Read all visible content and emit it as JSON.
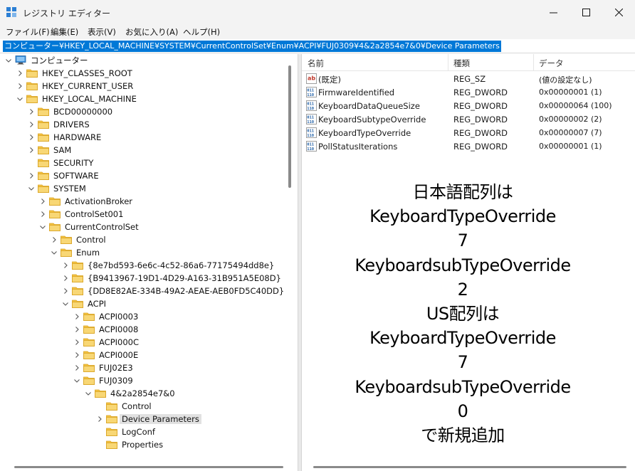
{
  "window": {
    "title": "レジストリ エディター",
    "minimize_icon": "minimize-icon",
    "maximize_icon": "maximize-icon",
    "close_icon": "close-icon"
  },
  "menu": [
    "ファイル(F)",
    "編集(E)",
    "表示(V)",
    "お気に入り(A)",
    "ヘルプ(H)"
  ],
  "address": "コンピューター¥HKEY_LOCAL_MACHINE¥SYSTEM¥CurrentControlSet¥Enum¥ACPI¥FUJ0309¥4&2a2854e7&0¥Device Parameters",
  "tree": [
    {
      "label": "コンピューター",
      "depth": 0,
      "state": "open",
      "icon": "computer-icon"
    },
    {
      "label": "HKEY_CLASSES_ROOT",
      "depth": 1,
      "state": "closed"
    },
    {
      "label": "HKEY_CURRENT_USER",
      "depth": 1,
      "state": "closed"
    },
    {
      "label": "HKEY_LOCAL_MACHINE",
      "depth": 1,
      "state": "open"
    },
    {
      "label": "BCD00000000",
      "depth": 2,
      "state": "closed"
    },
    {
      "label": "DRIVERS",
      "depth": 2,
      "state": "closed"
    },
    {
      "label": "HARDWARE",
      "depth": 2,
      "state": "closed"
    },
    {
      "label": "SAM",
      "depth": 2,
      "state": "closed"
    },
    {
      "label": "SECURITY",
      "depth": 2,
      "state": "none"
    },
    {
      "label": "SOFTWARE",
      "depth": 2,
      "state": "closed"
    },
    {
      "label": "SYSTEM",
      "depth": 2,
      "state": "open"
    },
    {
      "label": "ActivationBroker",
      "depth": 3,
      "state": "closed"
    },
    {
      "label": "ControlSet001",
      "depth": 3,
      "state": "closed"
    },
    {
      "label": "CurrentControlSet",
      "depth": 3,
      "state": "open"
    },
    {
      "label": "Control",
      "depth": 4,
      "state": "closed"
    },
    {
      "label": "Enum",
      "depth": 4,
      "state": "open"
    },
    {
      "label": "{8e7bd593-6e6c-4c52-86a6-77175494dd8e}",
      "depth": 5,
      "state": "closed"
    },
    {
      "label": "{B9413967-19D1-4D29-A163-31B951A5E08D}",
      "depth": 5,
      "state": "closed"
    },
    {
      "label": "{DD8E82AE-334B-49A2-AEAE-AEB0FD5C40DD}",
      "depth": 5,
      "state": "closed"
    },
    {
      "label": "ACPI",
      "depth": 5,
      "state": "open"
    },
    {
      "label": "ACPI0003",
      "depth": 6,
      "state": "closed"
    },
    {
      "label": "ACPI0008",
      "depth": 6,
      "state": "closed"
    },
    {
      "label": "ACPI000C",
      "depth": 6,
      "state": "closed"
    },
    {
      "label": "ACPI000E",
      "depth": 6,
      "state": "closed"
    },
    {
      "label": "FUJ02E3",
      "depth": 6,
      "state": "closed"
    },
    {
      "label": "FUJ0309",
      "depth": 6,
      "state": "open"
    },
    {
      "label": "4&2a2854e7&0",
      "depth": 7,
      "state": "open"
    },
    {
      "label": "Control",
      "depth": 8,
      "state": "none"
    },
    {
      "label": "Device Parameters",
      "depth": 8,
      "state": "closed",
      "selected": true
    },
    {
      "label": "LogConf",
      "depth": 8,
      "state": "none"
    },
    {
      "label": "Properties",
      "depth": 8,
      "state": "none"
    }
  ],
  "columns": {
    "name": "名前",
    "type": "種類",
    "data": "データ"
  },
  "values": [
    {
      "icon": "string-value-icon",
      "name": "(既定)",
      "type": "REG_SZ",
      "data": "(値の設定なし)"
    },
    {
      "icon": "binary-value-icon",
      "name": "FirmwareIdentified",
      "type": "REG_DWORD",
      "data": "0x00000001 (1)"
    },
    {
      "icon": "binary-value-icon",
      "name": "KeyboardDataQueueSize",
      "type": "REG_DWORD",
      "data": "0x00000064 (100)"
    },
    {
      "icon": "binary-value-icon",
      "name": "KeyboardSubtypeOverride",
      "type": "REG_DWORD",
      "data": "0x00000002 (2)"
    },
    {
      "icon": "binary-value-icon",
      "name": "KeyboardTypeOverride",
      "type": "REG_DWORD",
      "data": "0x00000007 (7)"
    },
    {
      "icon": "binary-value-icon",
      "name": "PollStatusIterations",
      "type": "REG_DWORD",
      "data": "0x00000001 (1)"
    }
  ],
  "annotation": [
    "日本語配列は",
    "KeyboardTypeOverride",
    "7",
    "KeyboardsubTypeOverride",
    "2",
    "US配列は",
    "KeyboardTypeOverride",
    "7",
    "KeyboardsubTypeOverride",
    "0",
    "で新規追加"
  ],
  "colors": {
    "selection_blue": "#0078d7",
    "folder_yellow": "#f5c342",
    "tree_selected_gray": "#e1e1e1"
  }
}
